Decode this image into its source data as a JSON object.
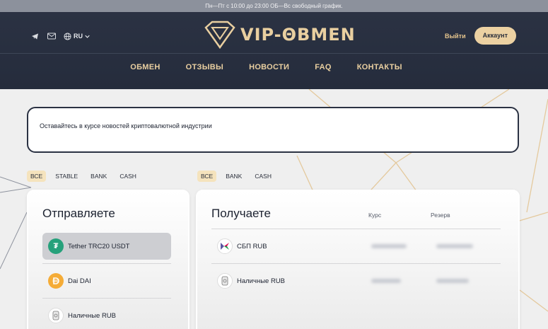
{
  "topbar": {
    "text": "Пн—Пт с 10:00 до 23:00 ОБ—Вс свободный график."
  },
  "header": {
    "lang": "RU",
    "logo_text": "VIP-ΘBMEN",
    "login_label": "Выйти",
    "account_label": "Аккаунт",
    "nav": [
      "ОБМЕН",
      "ОТЗЫВЫ",
      "НОВОСТИ",
      "FAQ",
      "КОНТАКТЫ"
    ]
  },
  "news": {
    "text": "Оставайтесь в курсе новостей криптовалютной индустрии"
  },
  "send": {
    "title": "Отправляете",
    "filters": [
      "ВСЕ",
      "STABLE",
      "BANK",
      "CASH"
    ],
    "items": [
      {
        "name": "Tether TRC20 USDT",
        "icon": "tether-icon"
      },
      {
        "name": "Dai DAI",
        "icon": "dai-icon"
      },
      {
        "name": "Наличные RUB",
        "icon": "cash-icon"
      }
    ]
  },
  "receive": {
    "title": "Получаете",
    "filters": [
      "ВСЕ",
      "BANK",
      "CASH"
    ],
    "col_rate": "Курс",
    "col_reserve": "Резерв",
    "items": [
      {
        "name": "СБП RUB",
        "icon": "sbp-icon"
      },
      {
        "name": "Наличные RUB",
        "icon": "cash-icon"
      }
    ]
  },
  "colors": {
    "accent": "#ecd1a2",
    "header_bg": "#2b3243",
    "tether": "#26a17b",
    "dai": "#f5ac37"
  }
}
